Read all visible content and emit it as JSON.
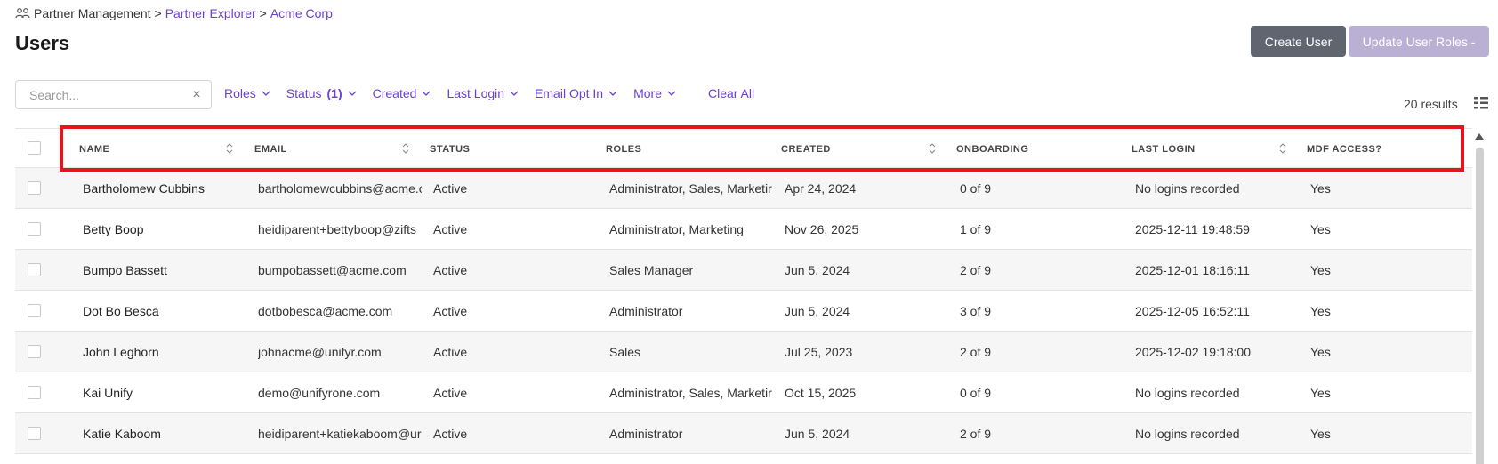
{
  "breadcrumb": {
    "root": "Partner Management",
    "sep": ">",
    "mid": "Partner Explorer",
    "current": "Acme Corp"
  },
  "page": {
    "title": "Users"
  },
  "actions": {
    "create_user": "Create User",
    "update_roles": "Update User Roles -"
  },
  "search": {
    "placeholder": "Search...",
    "value": ""
  },
  "filters": [
    {
      "label": "Roles"
    },
    {
      "label": "Status",
      "count": "(1)"
    },
    {
      "label": "Created"
    },
    {
      "label": "Last Login"
    },
    {
      "label": "Email Opt In"
    },
    {
      "label": "More"
    }
  ],
  "clear_all": "Clear All",
  "results": "20 results",
  "columns": [
    "NAME",
    "EMAIL",
    "STATUS",
    "ROLES",
    "CREATED",
    "ONBOARDING",
    "LAST LOGIN",
    "MDF ACCESS?"
  ],
  "rows": [
    [
      "Bartholomew Cubbins",
      "bartholomewcubbins@acme.c",
      "Active",
      "Administrator, Sales, Marketir",
      "Apr 24, 2024",
      "0 of 9",
      "No logins recorded",
      "Yes"
    ],
    [
      "Betty Boop",
      "heidiparent+bettyboop@zifts",
      "Active",
      "Administrator, Marketing",
      "Nov 26, 2025",
      "1 of 9",
      "2025-12-11 19:48:59",
      "Yes"
    ],
    [
      "Bumpo Bassett",
      "bumpobassett@acme.com",
      "Active",
      "Sales Manager",
      "Jun 5, 2024",
      "2 of 9",
      "2025-12-01 18:16:11",
      "Yes"
    ],
    [
      "Dot Bo Besca",
      "dotbobesca@acme.com",
      "Active",
      "Administrator",
      "Jun 5, 2024",
      "3 of 9",
      "2025-12-05 16:52:11",
      "Yes"
    ],
    [
      "John Leghorn",
      "johnacme@unifyr.com",
      "Active",
      "Sales",
      "Jul 25, 2023",
      "2 of 9",
      "2025-12-02 19:18:00",
      "Yes"
    ],
    [
      "Kai Unify",
      "demo@unifyrone.com",
      "Active",
      "Administrator, Sales, Marketir",
      "Oct 15, 2025",
      "0 of 9",
      "No logins recorded",
      "Yes"
    ],
    [
      "Katie Kaboom",
      "heidiparent+katiekaboom@ur",
      "Active",
      "Administrator",
      "Jun 5, 2024",
      "2 of 9",
      "No logins recorded",
      "Yes"
    ]
  ],
  "colors": {
    "accent": "#6b3fd4",
    "highlight": "#e3161f",
    "create_btn": "#5f6670",
    "update_btn": "#b9b0d4"
  }
}
